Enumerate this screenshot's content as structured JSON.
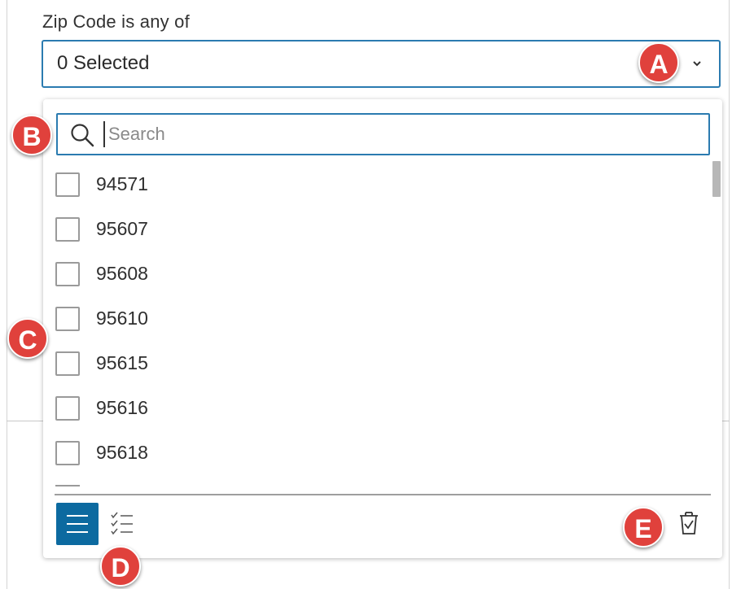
{
  "filter": {
    "label": "Zip Code is any of",
    "selected_text": "0 Selected"
  },
  "search": {
    "placeholder": "Search",
    "value": ""
  },
  "options": [
    "94571",
    "95607",
    "95608",
    "95610",
    "95615",
    "95616",
    "95618"
  ],
  "callouts": {
    "a": "A",
    "b": "B",
    "c": "C",
    "d": "D",
    "e": "E"
  },
  "colors": {
    "accent": "#2b7bb0",
    "active_button": "#0c6aa0",
    "callout": "#e0413c"
  },
  "icons": {
    "dropdown": "chevron-down-icon",
    "search": "search-icon",
    "list_view": "list-icon",
    "selected_view": "checklist-icon",
    "clear": "clear-selection-icon"
  }
}
